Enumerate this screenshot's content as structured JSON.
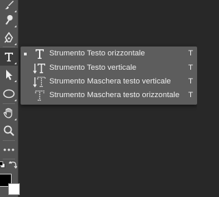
{
  "toolbar": {
    "tools": [
      {
        "name": "brush-icon"
      },
      {
        "name": "clone-stamp-icon"
      },
      {
        "name": "pen-icon"
      },
      {
        "name": "type-icon",
        "active": true
      },
      {
        "name": "path-selection-icon"
      },
      {
        "name": "ellipse-icon"
      },
      {
        "name": "hand-icon"
      },
      {
        "name": "zoom-icon"
      },
      {
        "name": "more-icon"
      },
      {
        "name": "default-colors-icon"
      },
      {
        "name": "swap-colors-icon"
      }
    ],
    "foreground_color": "#000000",
    "background_color": "#ffffff"
  },
  "flyout": {
    "items": [
      {
        "label": "Strumento Testo orizzontale",
        "shortcut": "T",
        "selected": true,
        "icon": "horizontal-type-icon"
      },
      {
        "label": "Strumento Testo verticale",
        "shortcut": "T",
        "selected": false,
        "icon": "vertical-type-icon"
      },
      {
        "label": "Strumento Maschera testo verticale",
        "shortcut": "T",
        "selected": false,
        "icon": "vertical-type-mask-icon"
      },
      {
        "label": "Strumento Maschera testo orizzontale",
        "shortcut": "T",
        "selected": false,
        "icon": "horizontal-type-mask-icon"
      }
    ]
  },
  "colors": {
    "toolbar_bg": "#535353",
    "flyout_bg": "#5d5d5d",
    "canvas_bg": "#282828",
    "text": "#efefef"
  }
}
